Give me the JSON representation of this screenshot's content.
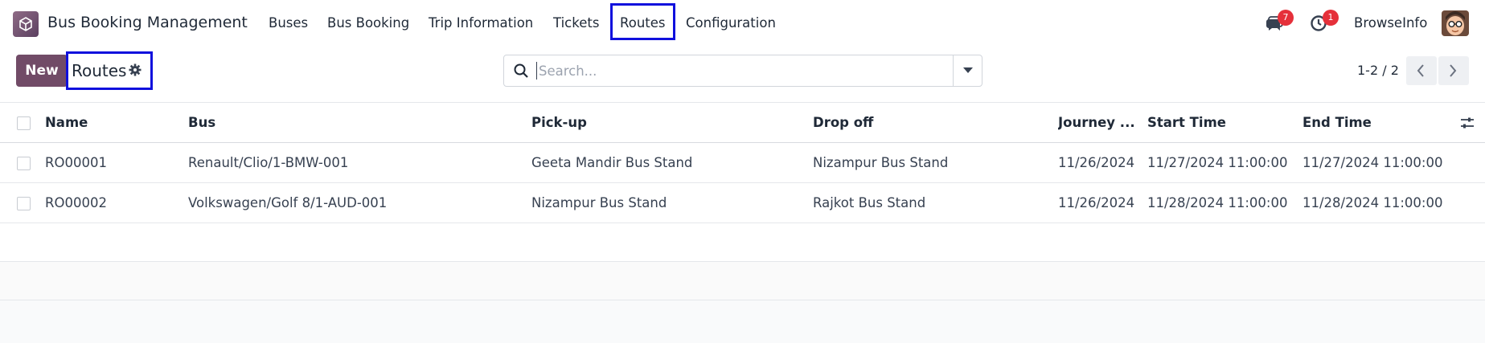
{
  "app": {
    "name": "Bus Booking Management",
    "logo_icon": "box-cube-icon",
    "brand_color": "#714b67"
  },
  "menu": {
    "items": [
      {
        "label": "Buses"
      },
      {
        "label": "Bus Booking"
      },
      {
        "label": "Trip Information"
      },
      {
        "label": "Tickets"
      },
      {
        "label": "Routes",
        "active": true
      },
      {
        "label": "Configuration"
      }
    ],
    "highlight_color": "#1010dd"
  },
  "systray": {
    "messages_count": "7",
    "activities_count": "1",
    "company": "BrowseInfo",
    "badge_color": "#e5303a"
  },
  "control_panel": {
    "new_label": "New",
    "breadcrumb_title": "Routes",
    "search_placeholder": "Search...",
    "pager": "1-2 / 2"
  },
  "table": {
    "columns": [
      "Name",
      "Bus",
      "Pick-up",
      "Drop off",
      "Journey ...",
      "Start Time",
      "End Time"
    ],
    "rows": [
      {
        "name": "RO00001",
        "bus": "Renault/Clio/1-BMW-001",
        "pickup": "Geeta Mandir Bus Stand",
        "dropoff": "Nizampur Bus Stand",
        "journey": "11/26/2024",
        "start": "11/27/2024 11:00:00",
        "end": "11/27/2024 11:00:00"
      },
      {
        "name": "RO00002",
        "bus": "Volkswagen/Golf 8/1-AUD-001",
        "pickup": "Nizampur Bus Stand",
        "dropoff": "Rajkot Bus Stand",
        "journey": "11/26/2024",
        "start": "11/28/2024 11:00:00",
        "end": "11/28/2024 11:00:00"
      }
    ]
  }
}
